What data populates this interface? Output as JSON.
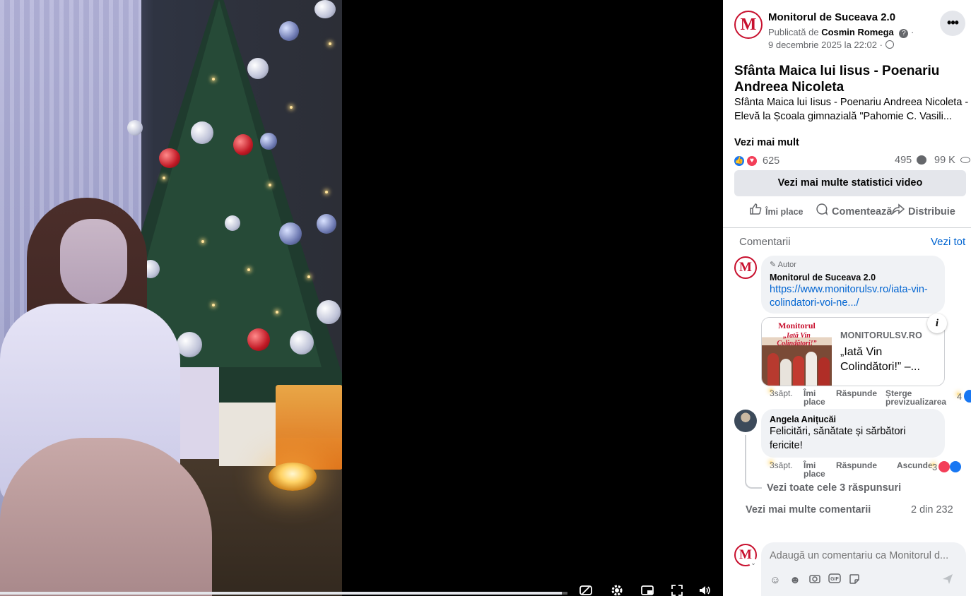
{
  "video": {
    "progress_fraction": 0.99,
    "controls": {
      "captions_icon": "captions-off-icon",
      "settings_icon": "gear-icon",
      "pip_icon": "picture-in-picture-icon",
      "fullscreen_icon": "fullscreen-icon",
      "volume_icon": "volume-icon"
    }
  },
  "post": {
    "page_name": "Monitorul de Suceava 2.0",
    "published_by_prefix": "Publicată de",
    "published_by_name": "Cosmin Romega",
    "date": "9 decembrie 2025 la 22:02",
    "title": "Sfânta Maica lui Iisus - Poenariu Andreea Nicoleta",
    "description": "Sfânta Maica lui Iisus - Poenariu Andreea Nicoleta - Elevă la Școala gimnazială \"Pahomie C. Vasili...",
    "see_more": "Vezi mai mult",
    "reactions_count": "625",
    "comments_count": "495",
    "views_count": "99 K",
    "stats_button": "Vezi mai multe statistici video",
    "actions": {
      "like": "Îmi place",
      "comment": "Comentează",
      "share": "Distribuie"
    }
  },
  "comments": {
    "header": "Comentarii",
    "see_all": "Vezi tot",
    "items": [
      {
        "badge": "Autor",
        "name": "Monitorul de Suceava 2.0",
        "link_text": "https://www.monitorulsv.ro/iata-vin-colindatori-voi-ne.../",
        "preview": {
          "image_title": "Monitorul",
          "image_subtitle": "„Iată Vin Colindători!”",
          "domain": "MONITORULSV.RO",
          "title": "„Iată Vin Colindători!” –..."
        },
        "time": "3săpt.",
        "like": "Îmi place",
        "reply": "Răspunde",
        "extra": "Șterge previzualizarea",
        "reactions": "4"
      },
      {
        "name": "Angela Anițucăi",
        "text": "Felicitări, sănătate și sărbători fericite!",
        "time": "3săpt.",
        "like": "Îmi place",
        "reply": "Răspunde",
        "extra": "Ascunde",
        "reactions": "3",
        "replies_link": "Vezi toate cele 3 răspunsuri"
      }
    ],
    "more_comments": "Vezi mai multe comentarii",
    "count_of": "2 din 232",
    "input_placeholder": "Adaugă un comentariu ca Monitorul d..."
  },
  "colors": {
    "accent_blue": "#0064d1",
    "like_blue": "#1877f2",
    "love_red": "#f33e58",
    "brand_red": "#c8102e"
  }
}
